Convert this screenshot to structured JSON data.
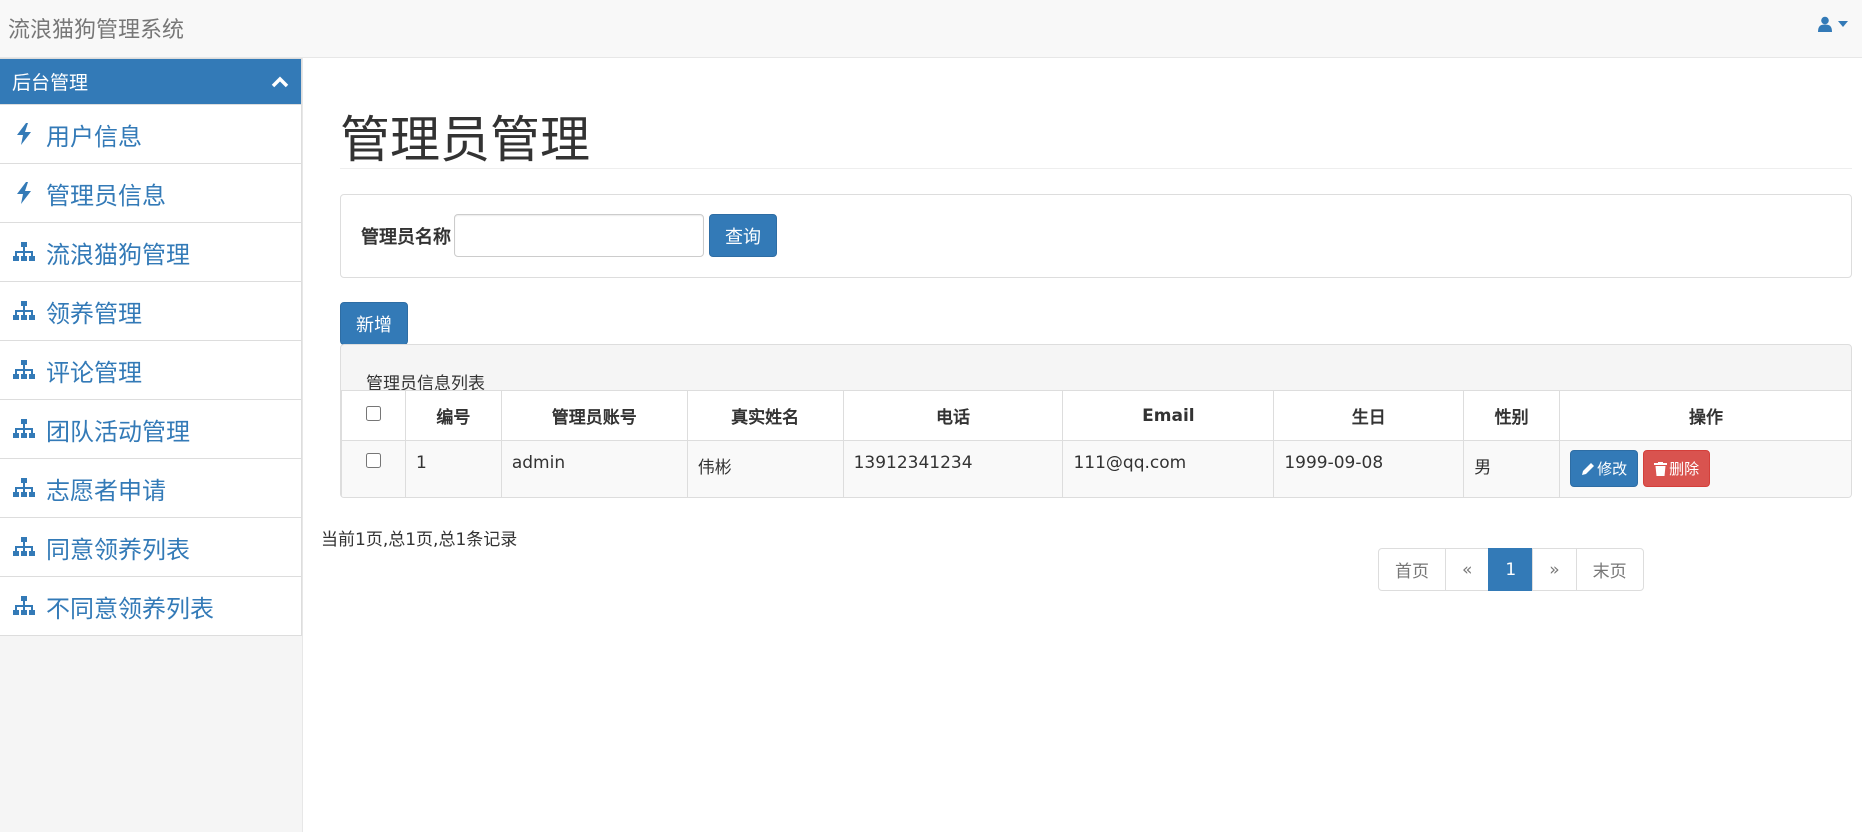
{
  "app": {
    "title": "流浪猫狗管理系统"
  },
  "sidebar": {
    "header": "后台管理",
    "items": [
      {
        "label": "用户信息",
        "icon": "bolt-icon"
      },
      {
        "label": "管理员信息",
        "icon": "bolt-icon"
      },
      {
        "label": "流浪猫狗管理",
        "icon": "sitemap-icon"
      },
      {
        "label": "领养管理",
        "icon": "sitemap-icon"
      },
      {
        "label": "评论管理",
        "icon": "sitemap-icon"
      },
      {
        "label": "团队活动管理",
        "icon": "sitemap-icon"
      },
      {
        "label": "志愿者申请",
        "icon": "sitemap-icon"
      },
      {
        "label": "同意领养列表",
        "icon": "sitemap-icon"
      },
      {
        "label": "不同意领养列表",
        "icon": "sitemap-icon"
      }
    ]
  },
  "main": {
    "title": "管理员管理",
    "search": {
      "label": "管理员名称",
      "value": "",
      "button": "查询"
    },
    "add_button": "新增",
    "table": {
      "caption": "管理员信息列表",
      "headers": [
        "编号",
        "管理员账号",
        "真实姓名",
        "电话",
        "Email",
        "生日",
        "性别",
        "操作"
      ],
      "rows": [
        {
          "id": "1",
          "account": "admin",
          "name": "伟彬",
          "phone": "13912341234",
          "email": "111@qq.com",
          "birthday": "1999-09-08",
          "gender": "男"
        }
      ],
      "edit_label": "修改",
      "delete_label": "删除"
    },
    "page_info": "当前1页,总1页,总1条记录",
    "pagination": {
      "first": "首页",
      "prev": "«",
      "current": "1",
      "next": "»",
      "last": "末页"
    }
  },
  "colors": {
    "primary": "#337ab7",
    "danger": "#d9534f"
  }
}
